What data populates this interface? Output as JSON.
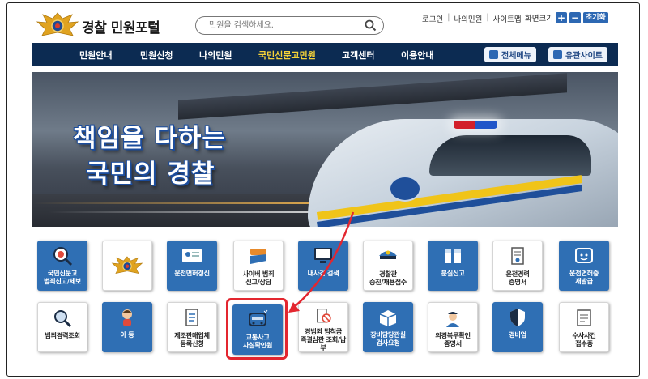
{
  "header": {
    "site_title": "경찰 민원포털",
    "search_placeholder": "민원을 검색하세요.",
    "util_links": [
      "로그인",
      "나의민원",
      "사이트맵"
    ],
    "zoom_label": "화면크기",
    "zoom_plus": "+",
    "zoom_minus": "−",
    "zoom_reset": "초기화"
  },
  "nav": {
    "items": [
      "민원안내",
      "민원신청",
      "나의민원",
      "국민신문고민원",
      "고객센터",
      "이용안내"
    ],
    "active_index": 3,
    "full_menu": "전체메뉴",
    "related_sites": "유관사이트"
  },
  "banner": {
    "line1": "책임을 다하는",
    "line2": "국민의 경찰"
  },
  "tiles": [
    {
      "label": "국민신문고\n범죄신고/제보",
      "icon": "magnifier-badge-icon",
      "style": "blue"
    },
    {
      "label": "",
      "icon": "police-emblem-icon",
      "style": "white"
    },
    {
      "label": "운전면허갱신",
      "icon": "license-card-icon",
      "style": "blue"
    },
    {
      "label": "사이버 범죄\n신고/상담",
      "icon": "cyber-shield-icon",
      "style": "white"
    },
    {
      "label": "내사건 검색",
      "icon": "monitor-icon",
      "style": "blue"
    },
    {
      "label": "경찰관\n승진/채용접수",
      "icon": "police-cap-icon",
      "style": "white"
    },
    {
      "label": "분실신고",
      "icon": "lost-box-icon",
      "style": "blue"
    },
    {
      "label": "운전경력\n증명서",
      "icon": "certificate-icon",
      "style": "white"
    },
    {
      "label": "운전면허증\n재발급",
      "icon": "reissue-card-icon",
      "style": "blue"
    },
    {
      "label": "범죄경력조회",
      "icon": "search-icon",
      "style": "white"
    },
    {
      "label": "아 동",
      "icon": "child-icon",
      "style": "blue"
    },
    {
      "label": "제조판매업체\n등록신청",
      "icon": "document-list-icon",
      "style": "white"
    },
    {
      "label": "교통사고\n사실확인원",
      "icon": "car-accident-icon",
      "style": "blue"
    },
    {
      "label": "경범죄 범칙금\n즉결심판 조회/납부",
      "icon": "fine-document-icon",
      "style": "white"
    },
    {
      "label": "장비담당관실\n검사요청",
      "icon": "equipment-box-icon",
      "style": "blue"
    },
    {
      "label": "의경복무확인\n증명서",
      "icon": "officer-icon",
      "style": "white"
    },
    {
      "label": "경비업",
      "icon": "security-shield-icon",
      "style": "blue"
    },
    {
      "label": "수사사건\n접수증",
      "icon": "receipt-icon",
      "style": "white"
    }
  ]
}
